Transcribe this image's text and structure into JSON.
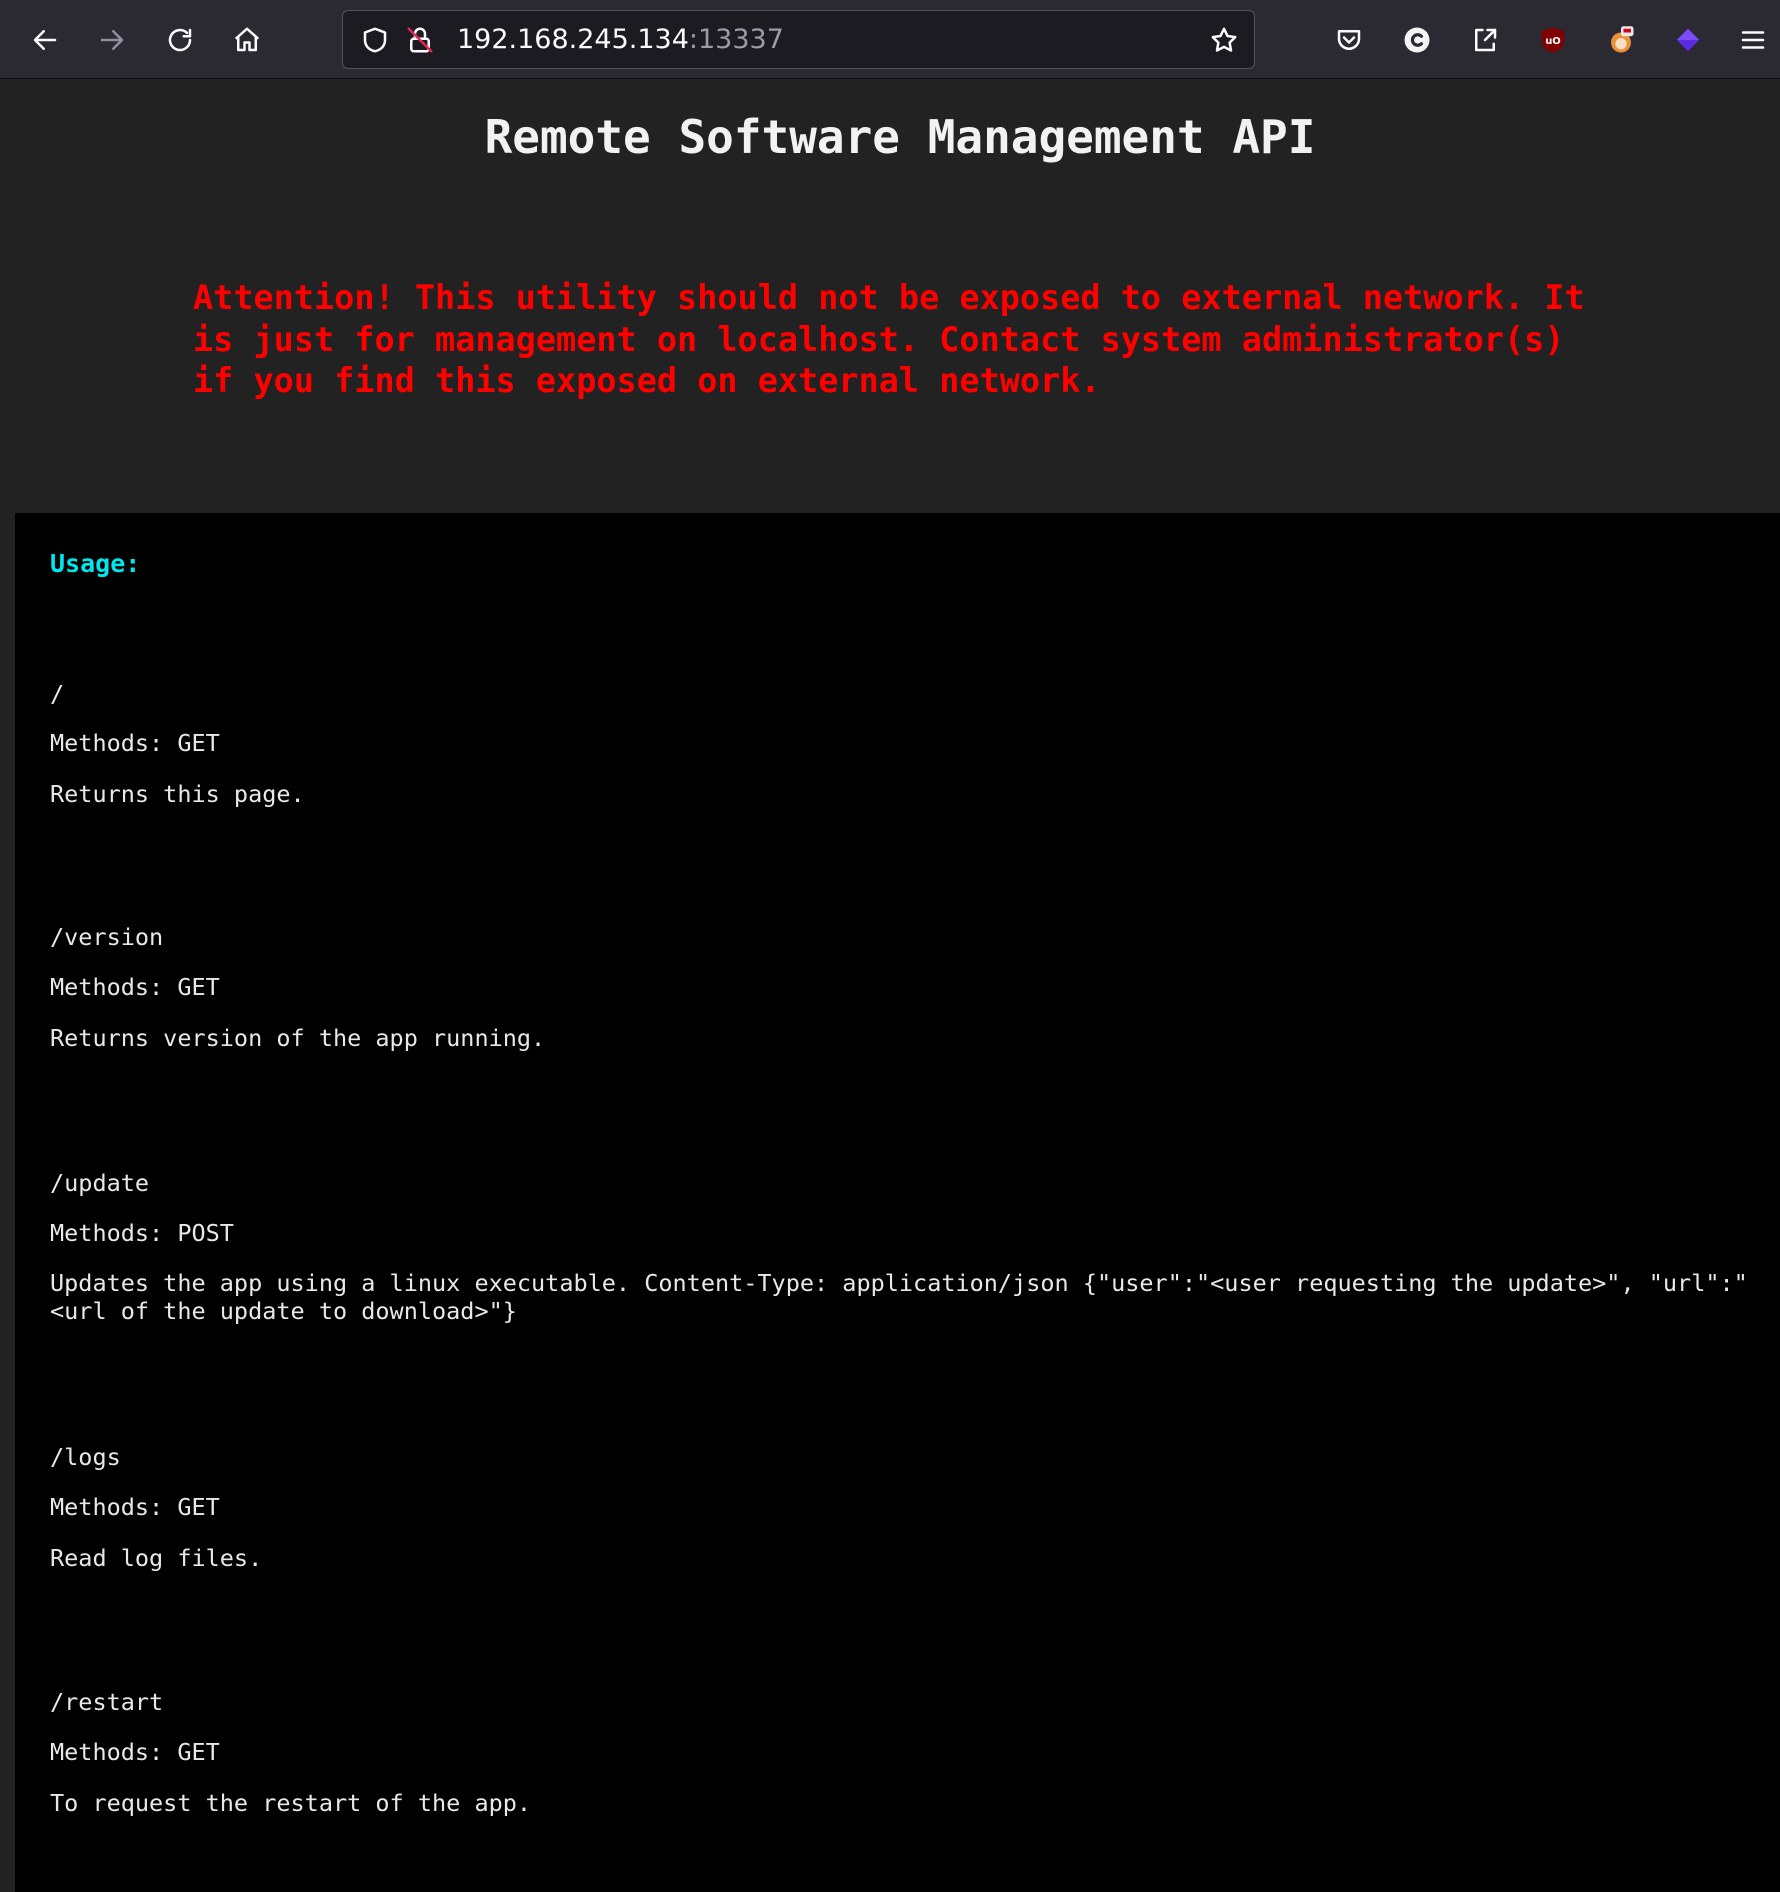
{
  "browser": {
    "url_host": "192.168.245.134",
    "url_port": ":13337",
    "icons": {
      "back": "back-arrow-icon",
      "forward": "forward-arrow-icon",
      "reload": "reload-icon",
      "home": "home-icon",
      "tracking": "shield-icon",
      "insecure": "insecure-lock-icon",
      "bookmark": "star-icon",
      "pocket": "pocket-icon",
      "ext1": "c-extension-icon",
      "share": "share-icon",
      "ublock": "ublock-origin-icon",
      "ext2": "fox-extension-icon",
      "ext3": "purple-cube-extension-icon",
      "menu": "hamburger-menu-icon"
    }
  },
  "page": {
    "title": "Remote Software Management API",
    "warning": "Attention! This utility should not be exposed to external network. It is just for management on localhost. Contact system administrator(s) if you find this exposed on external network.",
    "usage_label": "Usage:",
    "endpoints": [
      {
        "path": "/",
        "methods": "Methods: GET",
        "description": "Returns this page."
      },
      {
        "path": "/version",
        "methods": "Methods: GET",
        "description": "Returns version of the app running."
      },
      {
        "path": "/update",
        "methods": "Methods: POST",
        "description": "Updates the app using a linux executable. Content-Type: application/json {\"user\":\"<user requesting the update>\", \"url\":\"<url of the update to download>\"}"
      },
      {
        "path": "/logs",
        "methods": "Methods: GET",
        "description": "Read log files."
      },
      {
        "path": "/restart",
        "methods": "Methods: GET",
        "description": "To request the restart of the app."
      }
    ]
  },
  "colors": {
    "page_background": "#222222",
    "panel_background": "#000000",
    "warning": "#ff0000",
    "usage_label": "#00e5ee",
    "text": "#e8e8e8"
  }
}
